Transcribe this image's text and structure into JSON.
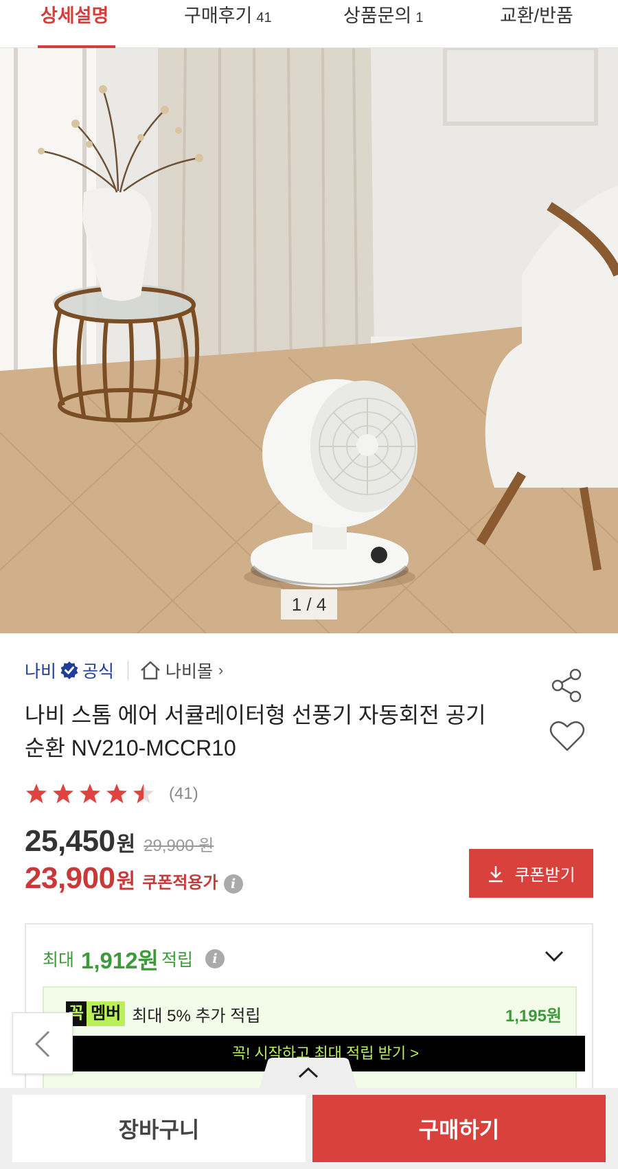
{
  "tabs": [
    {
      "label": "상세설명",
      "count": ""
    },
    {
      "label": "구매후기",
      "count": "41"
    },
    {
      "label": "상품문의",
      "count": "1"
    },
    {
      "label": "교환/반품",
      "count": ""
    }
  ],
  "hero": {
    "pager": "1 / 4"
  },
  "product": {
    "brand": "나비",
    "official": "공식",
    "mall_link": "나비몰",
    "title": "나비 스톰 에어 서큘레이터형 선풍기 자동회전 공기순환 NV210-MCCR10",
    "rating_value": 4.5,
    "rating_count": "(41)",
    "price": "25,450",
    "price_unit": "원",
    "original_price": "29,900 원",
    "coupon_price": "23,900",
    "coupon_price_unit": "원",
    "coupon_label": "쿠폰적용가",
    "coupon_button": "쿠폰받기"
  },
  "points": {
    "prefix": "최대",
    "amount": "1,912원",
    "suffix": "적립",
    "member": {
      "logo_part1": "꼭",
      "logo_part2": "멤버",
      "text": "최대 5% 추가 적립",
      "amount": "1,195원",
      "cta": "꼭! 시작하고 최대 적립 받기 >"
    }
  },
  "bottom": {
    "cart": "장바구니",
    "buy": "구매하기"
  },
  "colors": {
    "accent": "#d9413d",
    "brand_blue": "#1f3d9a",
    "points_green": "#3d9a3a",
    "member_lime": "#b9f05a"
  },
  "icons": {
    "official_badge": "verified-badge-icon",
    "mall": "home-icon",
    "share": "share-icon",
    "wishlist": "heart-icon",
    "coupon": "download-icon",
    "info": "info-icon",
    "toggle": "chevron-down-icon",
    "back": "chevron-left-icon",
    "pull": "chevron-up-icon"
  }
}
